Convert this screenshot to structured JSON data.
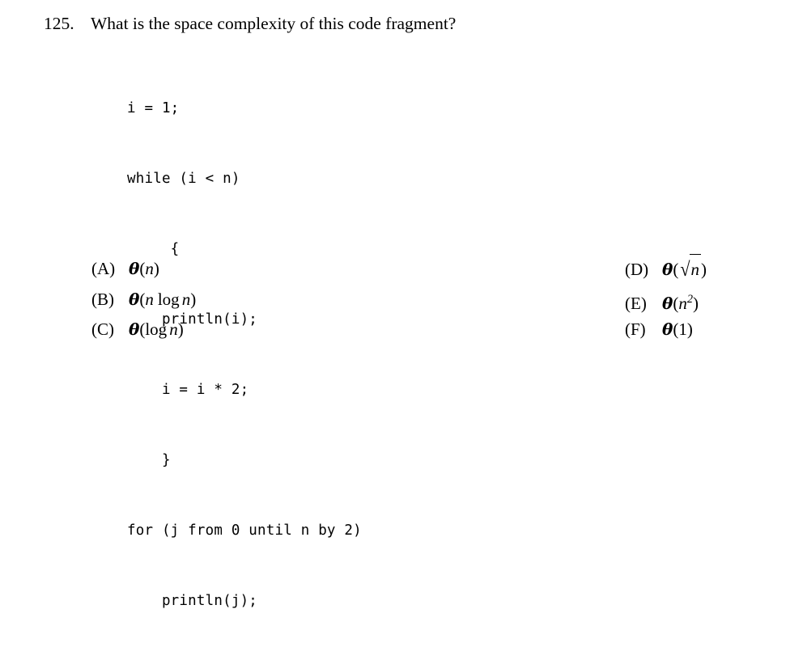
{
  "question": {
    "number": "125.",
    "text": "What is the space complexity of this code fragment?"
  },
  "code": {
    "language": "pseudocode",
    "lines": [
      "i = 1;",
      "while (i < n)",
      "     {",
      "    println(i);",
      "    i = i * 2;",
      "    }",
      "for (j from 0 until n by 2)",
      "    println(j);"
    ]
  },
  "options": {
    "left": [
      {
        "label": "(A)",
        "expr_plain": "θ(n)"
      },
      {
        "label": "(B)",
        "expr_plain": "θ(n log n)"
      },
      {
        "label": "(C)",
        "expr_plain": "θ(log n)"
      }
    ],
    "right": [
      {
        "label": "(D)",
        "expr_plain": "θ(√n)"
      },
      {
        "label": "(E)",
        "expr_plain": "θ(n²)"
      },
      {
        "label": "(F)",
        "expr_plain": "θ(1)"
      }
    ],
    "symbols": {
      "theta": "θ",
      "radical": "√",
      "variable_n": "n",
      "log": "log",
      "exponent_2": "2",
      "constant_1": "1",
      "open_paren": "(",
      "close_paren": ")"
    }
  },
  "colors": {
    "background": "#ffffff",
    "text": "#000000"
  }
}
